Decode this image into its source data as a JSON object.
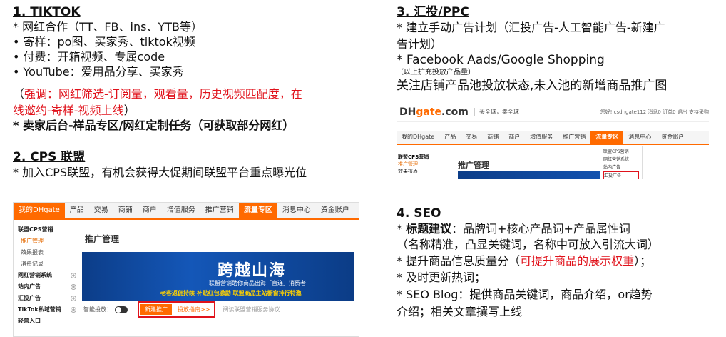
{
  "sections": {
    "tiktok": {
      "title": "1. TIKTOK",
      "lines": [
        "* 网红合作（TT、FB、ins、YTB等）",
        "• 寄样：po图、买家秀、tiktok视频",
        "• 付费：开箱视频、专属code",
        "• YouTube：爱用品分享、买家秀"
      ],
      "emphasis": "（强调：网红筛选-订阅量，观看量，历史视频匹配度，在线邀约-寄样-视频上线）",
      "emphasis_open": "（",
      "emphasis_red_1": "强调：网红筛选-订阅量，观看量，历史视频匹配度，在",
      "emphasis_red_2": "线邀约-寄样-视频上线",
      "emphasis_close": "）",
      "bold_line": "* 卖家后台-样品专区/网红定制任务（可获取部分网红）"
    },
    "cps": {
      "title": "2. CPS 联盟",
      "line": "* 加入CPS联盟，有机会获得大促期间联盟平台重点曝光位"
    },
    "ppc": {
      "title": "3. 汇投/PPC",
      "line1": "* 建立手动广告计划（汇投广告-人工智能广告-新建广",
      "line1b": "告计划）",
      "line2": "* Facebook Aads/Google Shopping",
      "note": "（以上扩充投放产品量）",
      "line3": "关注店铺产品池投放状态,未入池的新增商品推广图"
    },
    "seo": {
      "title": "4. SEO",
      "l1_star": "* ",
      "l1_bold": "标题建议",
      "l1_rest": "：品牌词+核心产品词+产品属性词",
      "l2": "（名称精准，凸显关键词，名称中可放入引流大词）",
      "l3_a": "* 提升商品信息质量分（",
      "l3_red": "可提升商品的展示权重",
      "l3_b": "）；",
      "l4": "*  及时更新热词；",
      "l5": "*  SEO Blog：提供商品关键词，商品介绍，or趋势",
      "l6": "介绍；相关文章撰写上线"
    }
  },
  "screenshot_left": {
    "tabs": [
      "我的DHgate",
      "产品",
      "交易",
      "商铺",
      "商户",
      "增值服务",
      "推广营销",
      "流量专区",
      "消息中心",
      "资金账户"
    ],
    "active_tab": "流量专区",
    "side": {
      "group1": "联盟CPS营销",
      "group1_items": [
        "推广管理",
        "效果报表",
        "消费记录"
      ],
      "groups": [
        "网红营销系统",
        "站内广告",
        "汇投广告",
        "TikTok私域营销",
        "轻营入口"
      ]
    },
    "page_title": "推广管理",
    "banner_big": "跨越山海",
    "banner_sub": "联盟营销助你商品出海「直连」消费者",
    "banner_gold": "老客返佣持续  补贴红包激励  联盟商品主站橱窗排行特邀",
    "toggle_label": "智能投放：",
    "btn_new": "新建推广",
    "btn_guide": "投放指南>>",
    "agree": "阅读联盟营销服务协议"
  },
  "screenshot_right": {
    "logo_a": "DH",
    "logo_b": "gate",
    "logo_c": ".com",
    "slogan": "买全球，卖全球",
    "userbar": "您好! csdhgate112  消息0  订单0  退出  支持采购",
    "tabs": [
      "我的DHgate",
      "产品",
      "交易",
      "商铺",
      "商户",
      "增值服务",
      "推广营销",
      "流量专区",
      "消息中心",
      "资金账户"
    ],
    "active_tab": "流量专区",
    "dropdown": [
      "联盟CPS营销",
      "网红营销系统",
      "站内广告",
      "汇投广告"
    ],
    "dropdown_highlight": "汇投广告",
    "side": [
      "联盟CPS营销",
      "推广管理",
      "效果报表"
    ],
    "page_title": "推广管理"
  }
}
